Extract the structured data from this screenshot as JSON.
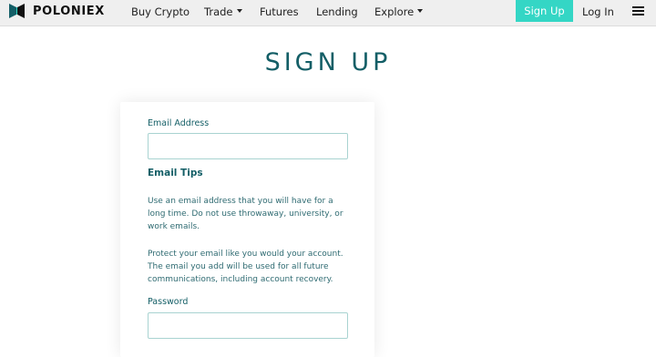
{
  "header": {
    "brand": "POLONIEX",
    "nav": [
      {
        "label": "Buy Crypto",
        "has_caret": false
      },
      {
        "label": "Trade",
        "has_caret": true
      },
      {
        "label": "Futures",
        "has_caret": false
      },
      {
        "label": "Lending",
        "has_caret": false
      },
      {
        "label": "Explore",
        "has_caret": true
      }
    ],
    "signup_label": "Sign Up",
    "login_label": "Log In",
    "menu_icon": "hamburger-menu-icon"
  },
  "page": {
    "title": "SIGN UP"
  },
  "form": {
    "email_label": "Email Address",
    "email_value": "",
    "tips_title": "Email Tips",
    "tips_paragraph_1": "Use an email address that you will have for a long time. Do not use throwaway, university, or work emails.",
    "tips_paragraph_2": "Protect your email like you would your account. The email you add will be used for all future communications, including account recovery.",
    "password_label": "Password",
    "password_value": ""
  },
  "colors": {
    "accent": "#34d6c5",
    "title": "#135e66",
    "header_bg": "#efefef"
  }
}
